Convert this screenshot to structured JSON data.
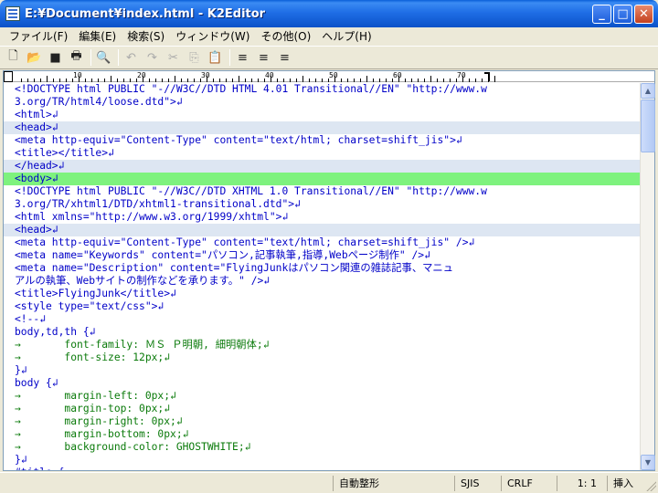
{
  "window": {
    "title": "E:¥Document¥index.html - K2Editor",
    "minimize": "_",
    "maximize": "□",
    "close": "✕"
  },
  "menu": [
    "ファイル(F)",
    "編集(E)",
    "検索(S)",
    "ウィンドウ(W)",
    "その他(O)",
    "ヘルプ(H)"
  ],
  "toolbar": {
    "icons": [
      "new-file-icon",
      "open-folder-icon",
      "save-icon",
      "print-icon",
      "find-icon",
      "undo-icon",
      "redo-icon",
      "cut-icon",
      "copy-icon",
      "paste-icon",
      "align-left-icon",
      "align-center-icon",
      "align-right-icon"
    ],
    "glyphs": [
      "🗋",
      "📂",
      "■",
      "🖶",
      "🔍",
      "↶",
      "↷",
      "✂",
      "⎘",
      "📋",
      "≡",
      "≡",
      "≡"
    ]
  },
  "ruler": {
    "labels": [
      "10",
      "20",
      "30",
      "40",
      "50",
      "60",
      "70"
    ]
  },
  "editor": {
    "highlight_color": "#dde6f2",
    "current_line_color": "#7ef27e",
    "lines": [
      {
        "c": "tag",
        "t": "<!DOCTYPE html PUBLIC \"-//W3C//DTD HTML 4.01 Transitional//EN\" \"http://www.w"
      },
      {
        "c": "tag",
        "t": "3.org/TR/html4/loose.dtd\">↲"
      },
      {
        "c": "tag",
        "t": "<html>↲"
      },
      {
        "c": "tag hl",
        "t": "<head>↲"
      },
      {
        "c": "tag",
        "t": "<meta http-equiv=\"Content-Type\" content=\"text/html; charset=shift_jis\">↲"
      },
      {
        "c": "tag",
        "t": "<title></title>↲"
      },
      {
        "c": "tag hl",
        "t": "</head>↲"
      },
      {
        "c": "tag cur",
        "t": "<body>↲"
      },
      {
        "c": "tag",
        "t": "<!DOCTYPE html PUBLIC \"-//W3C//DTD XHTML 1.0 Transitional//EN\" \"http://www.w"
      },
      {
        "c": "tag",
        "t": "3.org/TR/xhtml1/DTD/xhtml1-transitional.dtd\">↲"
      },
      {
        "c": "tag",
        "t": "<html xmlns=\"http://www.w3.org/1999/xhtml\">↲"
      },
      {
        "c": "tag hl",
        "t": "<head>↲"
      },
      {
        "c": "tag",
        "t": "<meta http-equiv=\"Content-Type\" content=\"text/html; charset=shift_jis\" />↲"
      },
      {
        "c": "tag",
        "t": "<meta name=\"Keywords\" content=\"パソコン,記事執筆,指導,Webページ制作\" />↲"
      },
      {
        "c": "tag",
        "t": "<meta name=\"Description\" content=\"FlyingJunkはパソコン関連の雑誌記事、マニュ"
      },
      {
        "c": "tag",
        "t": "アルの執筆、Webサイトの制作などを承ります。\" />↲"
      },
      {
        "c": "tag",
        "t": "<title>FlyingJunk</title>↲"
      },
      {
        "c": "tag",
        "t": "<style type=\"text/css\">↲"
      },
      {
        "c": "tag",
        "t": "<!--↲"
      },
      {
        "c": "tag",
        "t": "body,td,th {↲"
      },
      {
        "c": "str",
        "t": "→       font-family: ＭＳ Ｐ明朝, 細明朝体;↲"
      },
      {
        "c": "str",
        "t": "→       font-size: 12px;↲"
      },
      {
        "c": "tag",
        "t": "}↲"
      },
      {
        "c": "tag",
        "t": "body {↲"
      },
      {
        "c": "str",
        "t": "→       margin-left: 0px;↲"
      },
      {
        "c": "str",
        "t": "→       margin-top: 0px;↲"
      },
      {
        "c": "str",
        "t": "→       margin-right: 0px;↲"
      },
      {
        "c": "str",
        "t": "→       margin-bottom: 0px;↲"
      },
      {
        "c": "str",
        "t": "→       background-color: GHOSTWHITE;↲"
      },
      {
        "c": "tag",
        "t": "}↲"
      },
      {
        "c": "tag",
        "t": "#title {"
      }
    ]
  },
  "status": {
    "auto_format": "自動整形",
    "encoding": "SJIS",
    "line_ending": "CRLF",
    "position": "1:  1",
    "mode": "挿入"
  }
}
